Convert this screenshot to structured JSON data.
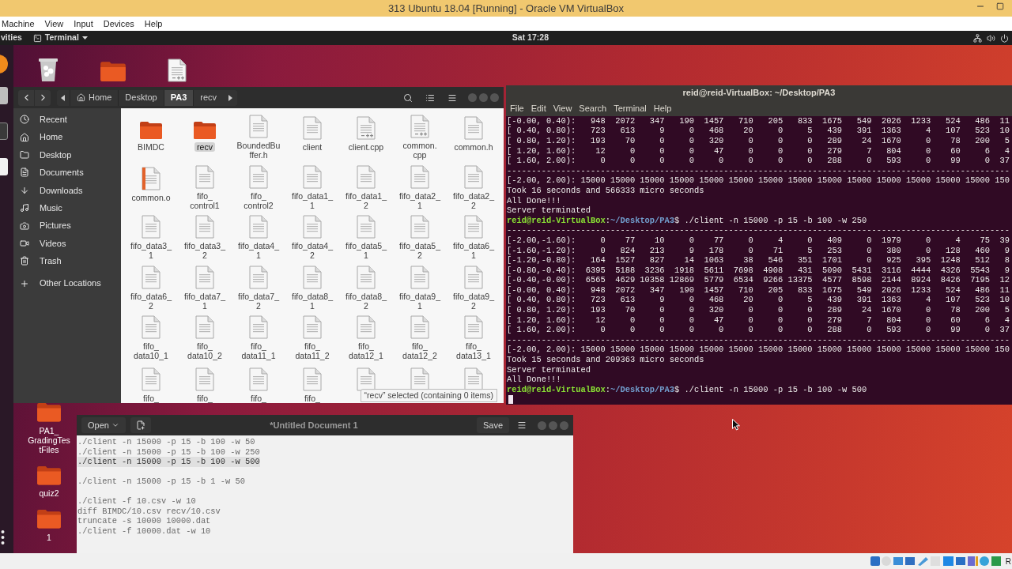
{
  "vbox": {
    "title": "313 Ubuntu 18.04 [Running] - Oracle VM VirtualBox",
    "menu": [
      "Machine",
      "View",
      "Input",
      "Devices",
      "Help"
    ],
    "host_key": "R"
  },
  "topbar": {
    "activities": "vities",
    "app": "Terminal",
    "clock": "Sat 17:28"
  },
  "desktop_icons": [
    {
      "kind": "trash"
    },
    {
      "kind": "folder"
    },
    {
      "kind": "cpp"
    }
  ],
  "desktop_folders": [
    {
      "label": "PA1_\nGradingTes\ntFiles"
    },
    {
      "label": "quiz2"
    },
    {
      "label": "1"
    }
  ],
  "files": {
    "path": [
      {
        "label": "Home",
        "selected": false
      },
      {
        "label": "Desktop",
        "selected": false
      },
      {
        "label": "PA3",
        "selected": true
      },
      {
        "label": "recv",
        "selected": false
      }
    ],
    "sidebar": [
      "Recent",
      "Home",
      "Desktop",
      "Documents",
      "Downloads",
      "Music",
      "Pictures",
      "Videos",
      "Trash"
    ],
    "other_locations": "Other Locations",
    "items": [
      {
        "name": "BIMDC",
        "kind": "folder",
        "selected": false
      },
      {
        "name": "recv",
        "kind": "folder",
        "selected": true
      },
      {
        "name": "BoundedBu\nffer.h",
        "kind": "doc",
        "selected": false
      },
      {
        "name": "client",
        "kind": "doc",
        "selected": false
      },
      {
        "name": "client.cpp",
        "kind": "cpp",
        "selected": false
      },
      {
        "name": "common.\ncpp",
        "kind": "cpp",
        "selected": false
      },
      {
        "name": "common.h",
        "kind": "doc",
        "selected": false
      },
      {
        "name": "common.o",
        "kind": "object",
        "selected": false
      },
      {
        "name": "fifo_\ncontrol1",
        "kind": "doc",
        "selected": false
      },
      {
        "name": "fifo_\ncontrol2",
        "kind": "doc",
        "selected": false
      },
      {
        "name": "fifo_data1_\n1",
        "kind": "doc",
        "selected": false
      },
      {
        "name": "fifo_data1_\n2",
        "kind": "doc",
        "selected": false
      },
      {
        "name": "fifo_data2_\n1",
        "kind": "doc",
        "selected": false
      },
      {
        "name": "fifo_data2_\n2",
        "kind": "doc",
        "selected": false
      },
      {
        "name": "fifo_data3_\n1",
        "kind": "doc",
        "selected": false
      },
      {
        "name": "fifo_data3_\n2",
        "kind": "doc",
        "selected": false
      },
      {
        "name": "fifo_data4_\n1",
        "kind": "doc",
        "selected": false
      },
      {
        "name": "fifo_data4_\n2",
        "kind": "doc",
        "selected": false
      },
      {
        "name": "fifo_data5_\n1",
        "kind": "doc",
        "selected": false
      },
      {
        "name": "fifo_data5_\n2",
        "kind": "doc",
        "selected": false
      },
      {
        "name": "fifo_data6_\n1",
        "kind": "doc",
        "selected": false
      },
      {
        "name": "fifo_data6_\n2",
        "kind": "doc",
        "selected": false
      },
      {
        "name": "fifo_data7_\n1",
        "kind": "doc",
        "selected": false
      },
      {
        "name": "fifo_data7_\n2",
        "kind": "doc",
        "selected": false
      },
      {
        "name": "fifo_data8_\n1",
        "kind": "doc",
        "selected": false
      },
      {
        "name": "fifo_data8_\n2",
        "kind": "doc",
        "selected": false
      },
      {
        "name": "fifo_data9_\n1",
        "kind": "doc",
        "selected": false
      },
      {
        "name": "fifo_data9_\n2",
        "kind": "doc",
        "selected": false
      },
      {
        "name": "fifo_\ndata10_1",
        "kind": "doc",
        "selected": false
      },
      {
        "name": "fifo_\ndata10_2",
        "kind": "doc",
        "selected": false
      },
      {
        "name": "fifo_\ndata11_1",
        "kind": "doc",
        "selected": false
      },
      {
        "name": "fifo_\ndata11_2",
        "kind": "doc",
        "selected": false
      },
      {
        "name": "fifo_\ndata12_1",
        "kind": "doc",
        "selected": false
      },
      {
        "name": "fifo_\ndata12_2",
        "kind": "doc",
        "selected": false
      },
      {
        "name": "fifo_\ndata13_1",
        "kind": "doc",
        "selected": false
      },
      {
        "name": "fifo_",
        "kind": "doc",
        "selected": false
      },
      {
        "name": "fifo_",
        "kind": "doc",
        "selected": false
      },
      {
        "name": "fifo_",
        "kind": "doc",
        "selected": false
      },
      {
        "name": "fifo_",
        "kind": "doc",
        "selected": false
      },
      {
        "kind": "doc",
        "selected": false
      },
      {
        "kind": "doc",
        "selected": false
      },
      {
        "kind": "doc",
        "selected": false
      }
    ],
    "status": "“recv” selected  (containing 0 items)"
  },
  "terminal": {
    "title": "reid@reid-VirtualBox: ~/Desktop/PA3",
    "menu": [
      "File",
      "Edit",
      "View",
      "Search",
      "Terminal",
      "Help"
    ],
    "lines": [
      {
        "kind": "output",
        "text": "[-0.00, 0.40):   948  2072   347   190  1457   710   205   833  1675   549  2026  1233   524   486  11"
      },
      {
        "kind": "output",
        "text": "[ 0.40, 0.80):   723   613     9     0   468    20     0     5   439   391  1363     4   107   523  10"
      },
      {
        "kind": "output",
        "text": "[ 0.80, 1.20):   193    70     0     0   320     0     0     0   289    24  1670     0    78   200   5"
      },
      {
        "kind": "output",
        "text": "[ 1.20, 1.60):    12     0     0     0    47     0     0     0   279     7   804     0    60     6   4"
      },
      {
        "kind": "output",
        "text": "[ 1.60, 2.00):     0     0     0     0     0     0     0     0   288     0   593     0    99     0  37"
      },
      {
        "kind": "output",
        "text": "------------------------------------------------------------------------------------------------------"
      },
      {
        "kind": "output",
        "text": "[-2.00, 2.00): 15000 15000 15000 15000 15000 15000 15000 15000 15000 15000 15000 15000 15000 15000 150"
      },
      {
        "kind": "output",
        "text": "Took 16 seconds and 566333 micro seconds"
      },
      {
        "kind": "output",
        "text": "All Done!!!"
      },
      {
        "kind": "output",
        "text": "Server terminated"
      },
      {
        "kind": "prompt",
        "user": "reid@reid-VirtualBox",
        "sep": ":",
        "path": "~/Desktop/PA3",
        "command": "$ ./client -n 15000 -p 15 -b 100 -w 250"
      },
      {
        "kind": "output",
        "text": "------------------------------------------------------------------------------------------------------"
      },
      {
        "kind": "output",
        "text": "[-2.00,-1.60):     0    77    10     0    77     0     4     0   409     0  1979     0     4    75  39"
      },
      {
        "kind": "output",
        "text": "[-1.60,-1.20):     0   824   213     9   178     0    71     5   253     0   380     0   128   460   9"
      },
      {
        "kind": "output",
        "text": "[-1.20,-0.80):   164  1527   827    14  1063    38   546   351  1701     0   925   395  1248   512   8"
      },
      {
        "kind": "output",
        "text": "[-0.80,-0.40):  6395  5188  3236  1918  5611  7698  4908   431  5090  5431  3116  4444  4326  5543   9"
      },
      {
        "kind": "output",
        "text": "[-0.40,-0.00):  6565  4629 10358 12869  5779  6534  9266 13375  4577  8598  2144  8924  8426  7195  12"
      },
      {
        "kind": "output",
        "text": "[-0.00, 0.40):   948  2072   347   190  1457   710   205   833  1675   549  2026  1233   524   486  11"
      },
      {
        "kind": "output",
        "text": "[ 0.40, 0.80):   723   613     9     0   468    20     0     5   439   391  1363     4   107   523  10"
      },
      {
        "kind": "output",
        "text": "[ 0.80, 1.20):   193    70     0     0   320     0     0     0   289    24  1670     0    78   200   5"
      },
      {
        "kind": "output",
        "text": "[ 1.20, 1.60):    12     0     0     0    47     0     0     0   279     7   804     0    60     6   4"
      },
      {
        "kind": "output",
        "text": "[ 1.60, 2.00):     0     0     0     0     0     0     0     0   288     0   593     0    99     0  37"
      },
      {
        "kind": "output",
        "text": "------------------------------------------------------------------------------------------------------"
      },
      {
        "kind": "output",
        "text": "[-2.00, 2.00): 15000 15000 15000 15000 15000 15000 15000 15000 15000 15000 15000 15000 15000 15000 150"
      },
      {
        "kind": "output",
        "text": "Took 15 seconds and 209363 micro seconds"
      },
      {
        "kind": "output",
        "text": "Server terminated"
      },
      {
        "kind": "output",
        "text": "All Done!!!"
      },
      {
        "kind": "prompt",
        "user": "reid@reid-VirtualBox",
        "sep": ":",
        "path": "~/Desktop/PA3",
        "command": "$ ./client -n 15000 -p 15 -b 100 -w 500"
      },
      {
        "kind": "cursor"
      }
    ]
  },
  "editor": {
    "open": "Open",
    "title": "*Untitled Document 1",
    "save": "Save",
    "blocks": [
      [
        {
          "text": "./client -n 15000 -p 15 -b 100 -w 50",
          "current": false
        },
        {
          "text": "./client -n 15000 -p 15 -b 100 -w 250",
          "current": false
        },
        {
          "text": "./client -n 15000 -p 15 -b 100 -w 500",
          "current": true
        }
      ],
      [
        {
          "text": "./client -n 15000 -p 15 -b 1 -w 50",
          "current": false
        }
      ],
      [
        {
          "text": "./client -f 10.csv -w 10",
          "current": false
        },
        {
          "text": "diff BIMDC/10.csv recv/10.csv",
          "current": false
        },
        {
          "text": "truncate -s 10000 10000.dat",
          "current": false
        },
        {
          "text": "./client -f 10000.dat -w 10",
          "current": false
        }
      ]
    ]
  }
}
